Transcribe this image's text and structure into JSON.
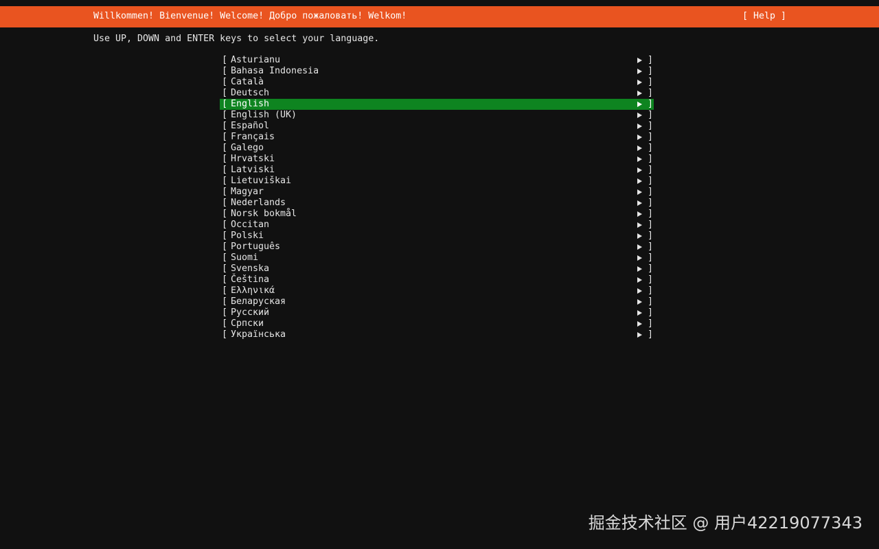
{
  "header": {
    "title": "Willkommen! Bienvenue! Welcome! Добро пожаловать! Welkom!",
    "help_label": "[ Help ]"
  },
  "instructions": "Use UP, DOWN and ENTER keys to select your language.",
  "list": {
    "bracket_open": "[",
    "bracket_close": "]",
    "item_icon": "arrow-right-icon",
    "selected_index": 4,
    "items": [
      {
        "label": "Asturianu"
      },
      {
        "label": "Bahasa Indonesia"
      },
      {
        "label": "Català"
      },
      {
        "label": "Deutsch"
      },
      {
        "label": "English"
      },
      {
        "label": "English (UK)"
      },
      {
        "label": "Español"
      },
      {
        "label": "Français"
      },
      {
        "label": "Galego"
      },
      {
        "label": "Hrvatski"
      },
      {
        "label": "Latviski"
      },
      {
        "label": "Lietuviškai"
      },
      {
        "label": "Magyar"
      },
      {
        "label": "Nederlands"
      },
      {
        "label": "Norsk bokmål"
      },
      {
        "label": "Occitan"
      },
      {
        "label": "Polski"
      },
      {
        "label": "Português"
      },
      {
        "label": "Suomi"
      },
      {
        "label": "Svenska"
      },
      {
        "label": "Čeština"
      },
      {
        "label": "Ελληνικά"
      },
      {
        "label": "Беларуская"
      },
      {
        "label": "Русский"
      },
      {
        "label": "Српски"
      },
      {
        "label": "Українська"
      }
    ]
  },
  "watermark": "掘金技术社区 @ 用户42219077343",
  "colors": {
    "background": "#111111",
    "header_bg": "#e95420",
    "selected_bg": "#0e8420",
    "text": "#e6e6e6"
  }
}
